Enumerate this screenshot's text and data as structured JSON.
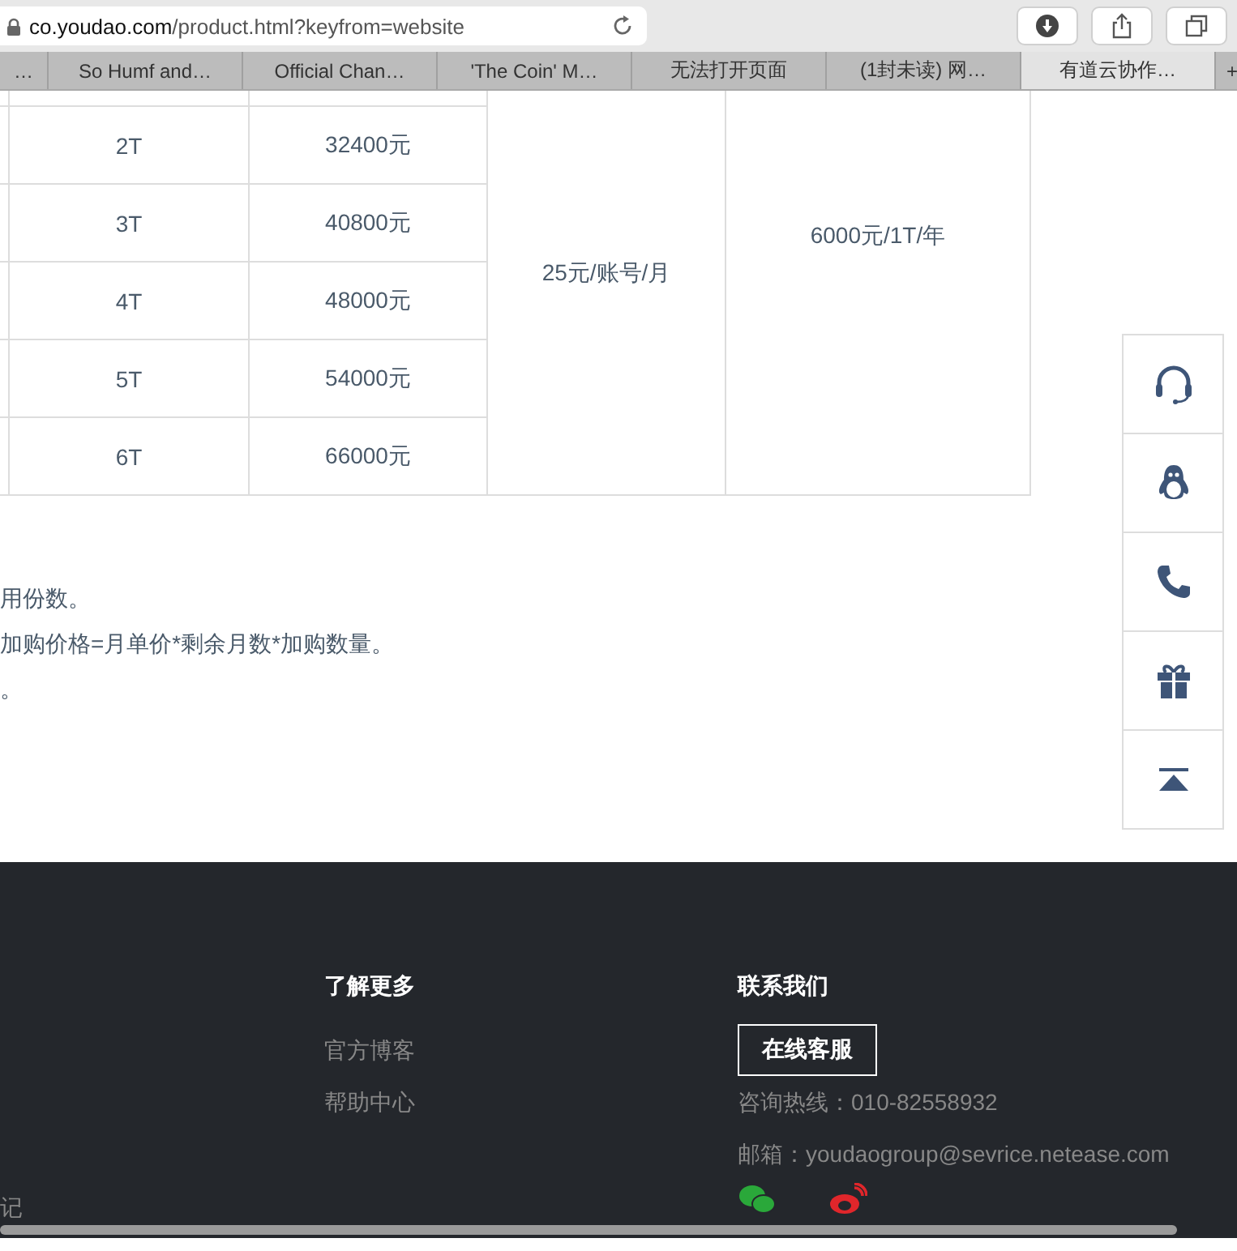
{
  "address_bar": {
    "host": "co.youdao.com",
    "path": "/product.html?keyfrom=website"
  },
  "tabs": [
    {
      "label": "…",
      "selected": false
    },
    {
      "label": "So Humf and…",
      "selected": false
    },
    {
      "label": "Official Chan…",
      "selected": false
    },
    {
      "label": "'The Coin' M…",
      "selected": false
    },
    {
      "label": "无法打开页面",
      "selected": false
    },
    {
      "label": "(1封未读) 网…",
      "selected": false
    },
    {
      "label": "有道云协作…",
      "selected": true
    },
    {
      "label": "+",
      "selected": false
    }
  ],
  "table": {
    "rows": [
      {
        "capacity": "2T",
        "price": "32400元"
      },
      {
        "capacity": "3T",
        "price": "40800元"
      },
      {
        "capacity": "4T",
        "price": "48000元"
      },
      {
        "capacity": "5T",
        "price": "54000元"
      },
      {
        "capacity": "6T",
        "price": "66000元"
      }
    ],
    "account_price": "25元/账号/月",
    "extra_storage_price": "6000元/1T/年"
  },
  "notes": [
    "用份数。",
    "加购价格=月单价*剩余月数*加购数量。",
    "。"
  ],
  "footer": {
    "left_text": "记",
    "learn_more": {
      "title": "了解更多",
      "links": [
        "官方博客",
        "帮助中心"
      ]
    },
    "contact": {
      "title": "联系我们",
      "button": "在线客服",
      "hotline": "咨询热线：010-82558932",
      "email": "邮箱：youdaogroup@sevrice.netease.com"
    }
  }
}
